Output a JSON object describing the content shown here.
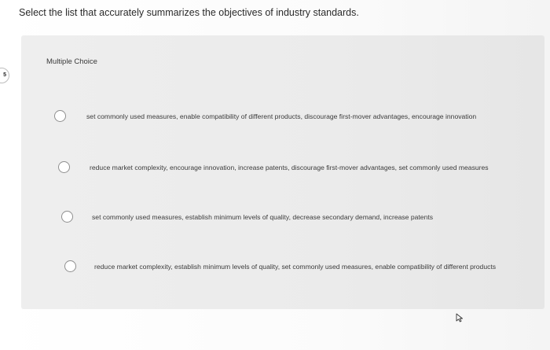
{
  "question": {
    "text": "Select the list that accurately summarizes the objectives of industry standards."
  },
  "panel": {
    "label": "Multiple Choice",
    "side_badge": "5"
  },
  "options": [
    {
      "label": "set commonly used measures, enable compatibility of different products, discourage first-mover advantages, encourage innovation",
      "selected": false
    },
    {
      "label": "reduce market complexity, encourage innovation, increase patents, discourage first-mover advantages, set commonly used measures",
      "selected": false
    },
    {
      "label": "set commonly used measures, establish minimum levels of quality, decrease secondary demand, increase patents",
      "selected": false
    },
    {
      "label": "reduce market complexity, establish minimum levels of quality, set commonly used measures, enable compatibility of different products",
      "selected": false
    }
  ],
  "icons": {
    "radio": "radio-unselected-icon",
    "cursor": "mouse-pointer-icon"
  }
}
